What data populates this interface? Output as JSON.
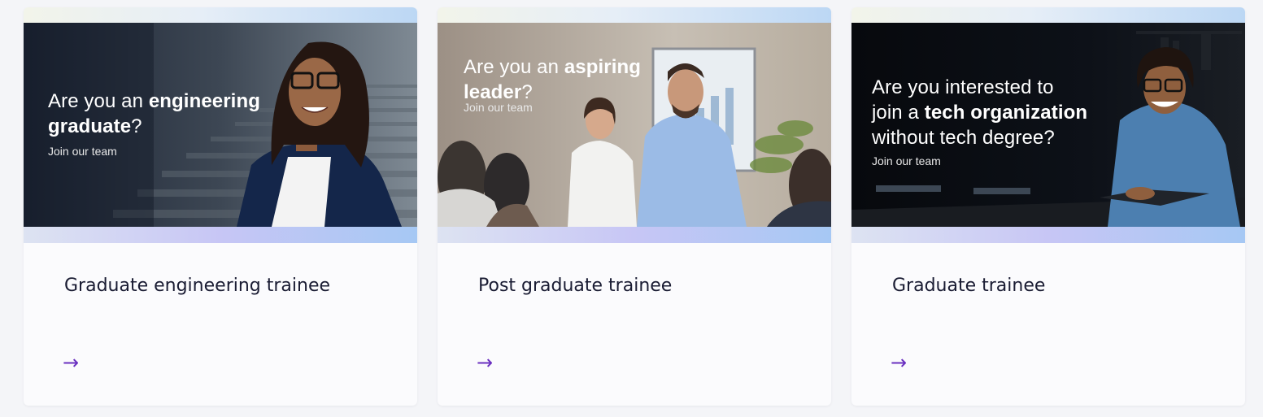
{
  "cards": [
    {
      "banner": {
        "line1_regular": "Are you an ",
        "line1_bold": "engineering",
        "line2_bold": "graduate",
        "line2_regular": "?",
        "sub": "Join our team"
      },
      "title": "Graduate engineering trainee",
      "arrow": "→"
    },
    {
      "banner": {
        "line1_regular": "Are you an ",
        "line1_bold": "aspiring",
        "line2_bold": "leader",
        "line2_regular": "?",
        "sub": "Join our team"
      },
      "title": "Post graduate trainee",
      "arrow": "→"
    },
    {
      "banner": {
        "line1_regular": "Are you interested to",
        "line2_regular": "join a ",
        "line2_bold": "tech organization",
        "line3_regular": "without tech degree?",
        "sub": "Join our team"
      },
      "title": "Graduate trainee",
      "arrow": "→"
    }
  ],
  "colors": {
    "page_background": "#f4f5f8",
    "card_background": "#fbfbfd",
    "title_text": "#1a1c33",
    "arrow_accent": "#6a2fc0"
  },
  "icons": [
    "arrow-right-icon"
  ]
}
